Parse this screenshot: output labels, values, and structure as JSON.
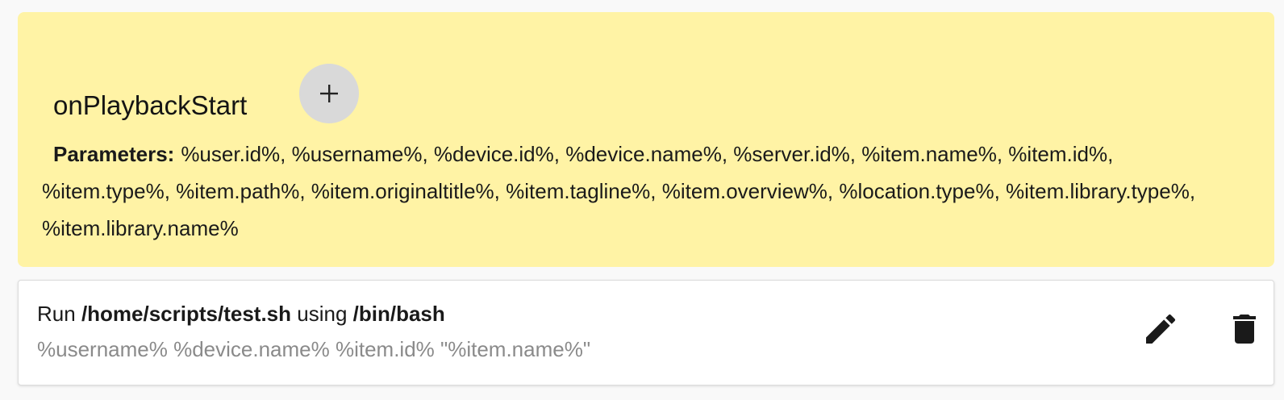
{
  "event": {
    "title": "onPlaybackStart",
    "add_button_label": "+",
    "params_label": "Parameters:",
    "params_list": "%user.id%, %username%, %device.id%, %device.name%, %server.id%, %item.name%, %item.id%, %item.type%, %item.path%, %item.originaltitle%, %item.tagline%, %item.overview%, %location.type%, %item.library.type%, %item.library.name%",
    "background_color": "#fff3a5"
  },
  "action": {
    "run_label": "Run",
    "script_path": "/home/scripts/test.sh",
    "using_label": "using",
    "interpreter": "/bin/bash",
    "arguments": "%username% %device.name% %item.id% \"%item.name%\"",
    "edit_icon": "pencil-icon",
    "delete_icon": "trash-icon"
  }
}
